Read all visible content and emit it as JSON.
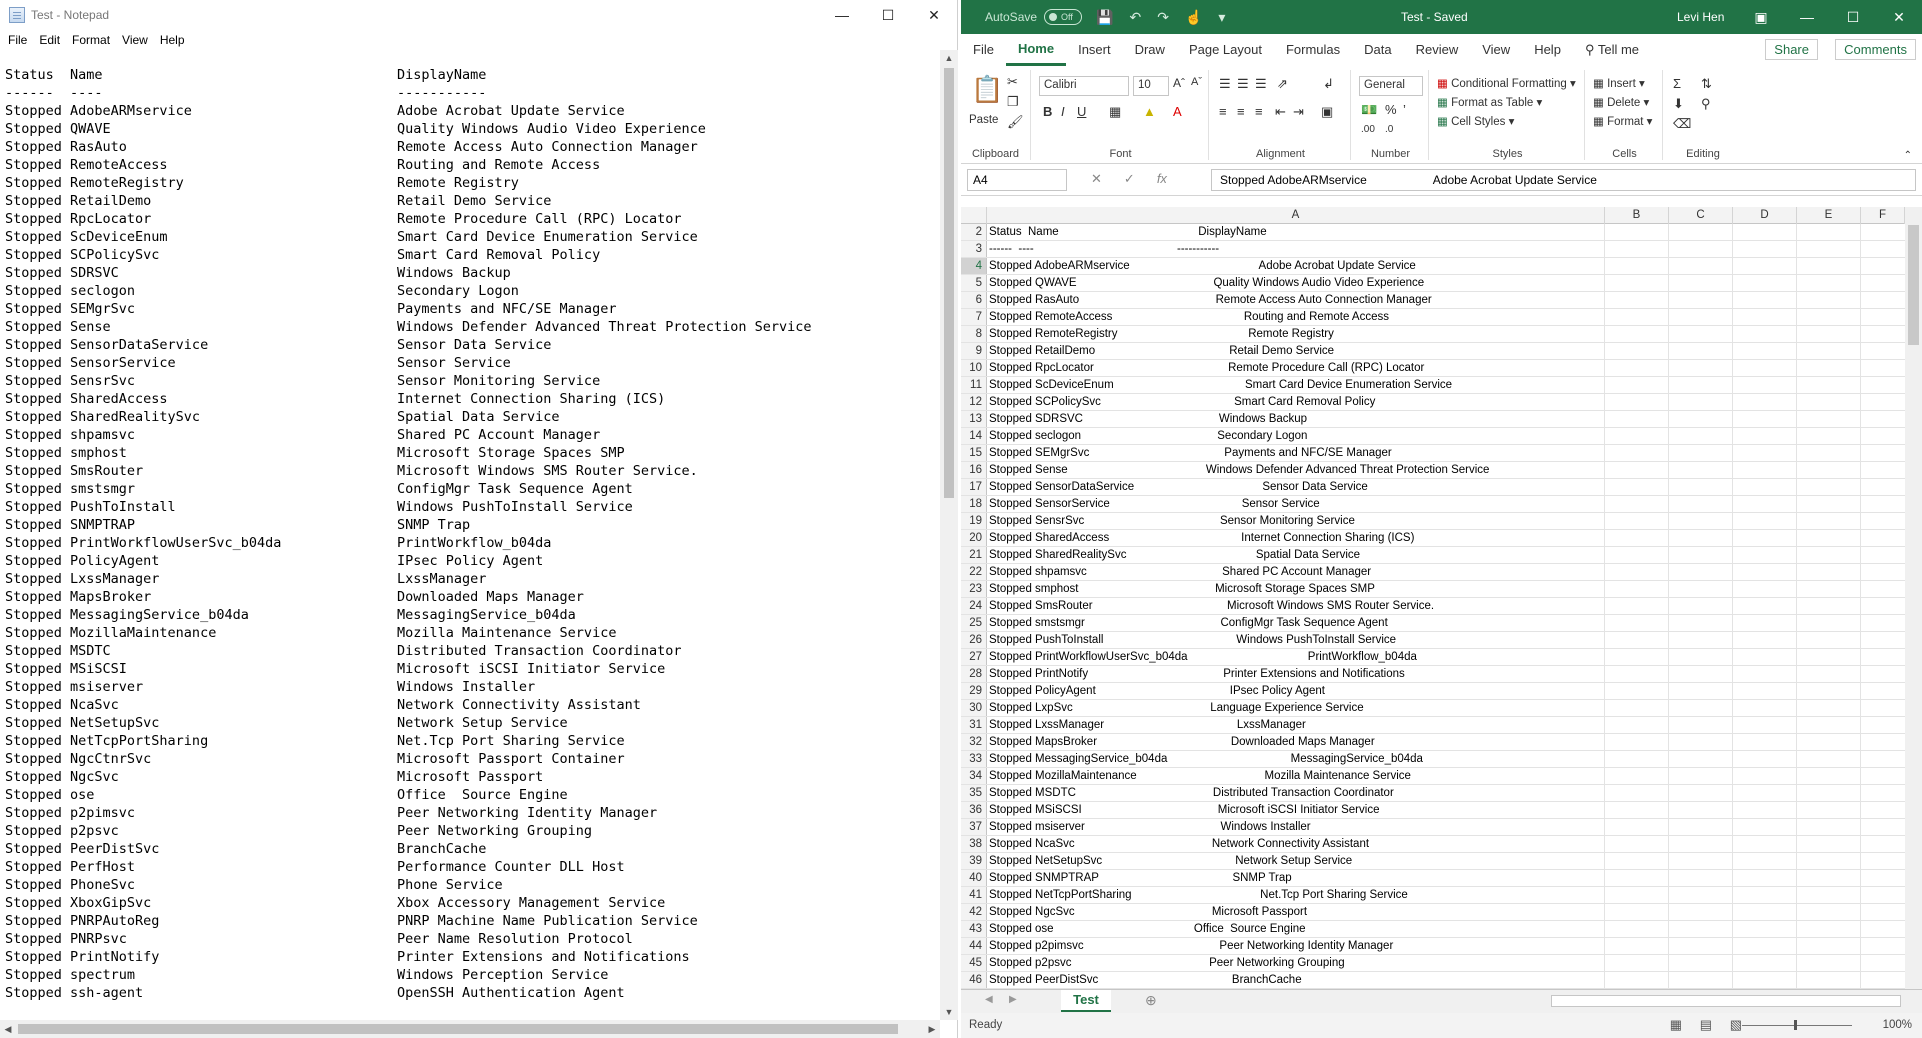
{
  "notepad": {
    "title": "Test - Notepad",
    "menu": [
      "File",
      "Edit",
      "Format",
      "View",
      "Help"
    ],
    "lines": [
      [
        "Status  Name",
        "DisplayName"
      ],
      [
        "------  ----",
        "-----------"
      ],
      [
        "Stopped AdobeARMservice",
        "Adobe Acrobat Update Service"
      ],
      [
        "Stopped QWAVE",
        "Quality Windows Audio Video Experience"
      ],
      [
        "Stopped RasAuto",
        "Remote Access Auto Connection Manager"
      ],
      [
        "Stopped RemoteAccess",
        "Routing and Remote Access"
      ],
      [
        "Stopped RemoteRegistry",
        "Remote Registry"
      ],
      [
        "Stopped RetailDemo",
        "Retail Demo Service"
      ],
      [
        "Stopped RpcLocator",
        "Remote Procedure Call (RPC) Locator"
      ],
      [
        "Stopped ScDeviceEnum",
        "Smart Card Device Enumeration Service"
      ],
      [
        "Stopped SCPolicySvc",
        "Smart Card Removal Policy"
      ],
      [
        "Stopped SDRSVC",
        "Windows Backup"
      ],
      [
        "Stopped seclogon",
        "Secondary Logon"
      ],
      [
        "Stopped SEMgrSvc",
        "Payments and NFC/SE Manager"
      ],
      [
        "Stopped Sense",
        "Windows Defender Advanced Threat Protection Service"
      ],
      [
        "Stopped SensorDataService",
        "Sensor Data Service"
      ],
      [
        "Stopped SensorService",
        "Sensor Service"
      ],
      [
        "Stopped SensrSvc",
        "Sensor Monitoring Service"
      ],
      [
        "Stopped SharedAccess",
        "Internet Connection Sharing (ICS)"
      ],
      [
        "Stopped SharedRealitySvc",
        "Spatial Data Service"
      ],
      [
        "Stopped shpamsvc",
        "Shared PC Account Manager"
      ],
      [
        "Stopped smphost",
        "Microsoft Storage Spaces SMP"
      ],
      [
        "Stopped SmsRouter",
        "Microsoft Windows SMS Router Service."
      ],
      [
        "Stopped smstsmgr",
        "ConfigMgr Task Sequence Agent"
      ],
      [
        "Stopped PushToInstall",
        "Windows PushToInstall Service"
      ],
      [
        "Stopped SNMPTRAP",
        "SNMP Trap"
      ],
      [
        "Stopped PrintWorkflowUserSvc_b04da",
        "PrintWorkflow_b04da"
      ],
      [
        "Stopped PolicyAgent",
        "IPsec Policy Agent"
      ],
      [
        "Stopped LxssManager",
        "LxssManager"
      ],
      [
        "Stopped MapsBroker",
        "Downloaded Maps Manager"
      ],
      [
        "Stopped MessagingService_b04da",
        "MessagingService_b04da"
      ],
      [
        "Stopped MozillaMaintenance",
        "Mozilla Maintenance Service"
      ],
      [
        "Stopped MSDTC",
        "Distributed Transaction Coordinator"
      ],
      [
        "Stopped MSiSCSI",
        "Microsoft iSCSI Initiator Service"
      ],
      [
        "Stopped msiserver",
        "Windows Installer"
      ],
      [
        "Stopped NcaSvc",
        "Network Connectivity Assistant"
      ],
      [
        "Stopped NetSetupSvc",
        "Network Setup Service"
      ],
      [
        "Stopped NetTcpPortSharing",
        "Net.Tcp Port Sharing Service"
      ],
      [
        "Stopped NgcCtnrSvc",
        "Microsoft Passport Container"
      ],
      [
        "Stopped NgcSvc",
        "Microsoft Passport"
      ],
      [
        "Stopped ose",
        "Office  Source Engine"
      ],
      [
        "Stopped p2pimsvc",
        "Peer Networking Identity Manager"
      ],
      [
        "Stopped p2psvc",
        "Peer Networking Grouping"
      ],
      [
        "Stopped PeerDistSvc",
        "BranchCache"
      ],
      [
        "Stopped PerfHost",
        "Performance Counter DLL Host"
      ],
      [
        "Stopped PhoneSvc",
        "Phone Service"
      ],
      [
        "Stopped XboxGipSvc",
        "Xbox Accessory Management Service"
      ],
      [
        "Stopped PNRPAutoReg",
        "PNRP Machine Name Publication Service"
      ],
      [
        "Stopped PNRPsvc",
        "Peer Name Resolution Protocol"
      ],
      [
        "Stopped PrintNotify",
        "Printer Extensions and Notifications"
      ],
      [
        "Stopped spectrum",
        "Windows Perception Service"
      ],
      [
        "Stopped ssh-agent",
        "OpenSSH Authentication Agent"
      ]
    ]
  },
  "excel": {
    "autosave_label": "AutoSave",
    "autosave_state": "Off",
    "doc_title": "Test - Saved",
    "user": "Levi Hen",
    "tabs": [
      "File",
      "Home",
      "Insert",
      "Draw",
      "Page Layout",
      "Formulas",
      "Data",
      "Review",
      "View",
      "Help"
    ],
    "tell_me": "Tell me",
    "share": "Share",
    "comments": "Comments",
    "ribbon": {
      "paste": "Paste",
      "clipboard": "Clipboard",
      "font_name": "Calibri",
      "font_size": "10",
      "font": "Font",
      "alignment": "Alignment",
      "number_format": "General",
      "number": "Number",
      "conditional_formatting": "Conditional Formatting",
      "format_as_table": "Format as Table",
      "cell_styles": "Cell Styles",
      "styles": "Styles",
      "insert": "Insert",
      "delete": "Delete",
      "format": "Format",
      "cells": "Cells",
      "editing": "Editing"
    },
    "name_box": "A4",
    "formula": "Stopped AdobeARMservice                    Adobe Acrobat Update Service",
    "columns": [
      "A",
      "B",
      "C",
      "D",
      "E",
      "F"
    ],
    "rows": [
      {
        "n": "2",
        "name": "Status  Name",
        "display": "DisplayName"
      },
      {
        "n": "3",
        "name": "------  ----",
        "display": "-----------"
      },
      {
        "n": "4",
        "name": "Stopped AdobeARMservice",
        "display": "Adobe Acrobat Update Service"
      },
      {
        "n": "5",
        "name": "Stopped QWAVE",
        "display": "Quality Windows Audio Video Experience"
      },
      {
        "n": "6",
        "name": "Stopped RasAuto",
        "display": "Remote Access Auto Connection Manager"
      },
      {
        "n": "7",
        "name": "Stopped RemoteAccess",
        "display": "Routing and Remote Access"
      },
      {
        "n": "8",
        "name": "Stopped RemoteRegistry",
        "display": "Remote Registry"
      },
      {
        "n": "9",
        "name": "Stopped RetailDemo",
        "display": "Retail Demo Service"
      },
      {
        "n": "10",
        "name": "Stopped RpcLocator",
        "display": "Remote Procedure Call (RPC) Locator"
      },
      {
        "n": "11",
        "name": "Stopped ScDeviceEnum",
        "display": "Smart Card Device Enumeration Service"
      },
      {
        "n": "12",
        "name": "Stopped SCPolicySvc",
        "display": "Smart Card Removal Policy"
      },
      {
        "n": "13",
        "name": "Stopped SDRSVC",
        "display": "Windows Backup"
      },
      {
        "n": "14",
        "name": "Stopped seclogon",
        "display": "Secondary Logon"
      },
      {
        "n": "15",
        "name": "Stopped SEMgrSvc",
        "display": "Payments and NFC/SE Manager"
      },
      {
        "n": "16",
        "name": "Stopped Sense",
        "display": "Windows Defender Advanced Threat Protection Service"
      },
      {
        "n": "17",
        "name": "Stopped SensorDataService",
        "display": "Sensor Data Service"
      },
      {
        "n": "18",
        "name": "Stopped SensorService",
        "display": "Sensor Service"
      },
      {
        "n": "19",
        "name": "Stopped SensrSvc",
        "display": "Sensor Monitoring Service"
      },
      {
        "n": "20",
        "name": "Stopped SharedAccess",
        "display": "Internet Connection Sharing (ICS)"
      },
      {
        "n": "21",
        "name": "Stopped SharedRealitySvc",
        "display": "Spatial Data Service"
      },
      {
        "n": "22",
        "name": "Stopped shpamsvc",
        "display": "Shared PC Account Manager"
      },
      {
        "n": "23",
        "name": "Stopped smphost",
        "display": "Microsoft Storage Spaces SMP"
      },
      {
        "n": "24",
        "name": "Stopped SmsRouter",
        "display": "Microsoft Windows SMS Router Service."
      },
      {
        "n": "25",
        "name": "Stopped smstsmgr",
        "display": "ConfigMgr Task Sequence Agent"
      },
      {
        "n": "26",
        "name": "Stopped PushToInstall",
        "display": "Windows PushToInstall Service"
      },
      {
        "n": "27",
        "name": "Stopped PrintWorkflowUserSvc_b04da",
        "display": "PrintWorkflow_b04da"
      },
      {
        "n": "28",
        "name": "Stopped PrintNotify",
        "display": "Printer Extensions and Notifications"
      },
      {
        "n": "29",
        "name": "Stopped PolicyAgent",
        "display": "IPsec Policy Agent"
      },
      {
        "n": "30",
        "name": "Stopped LxpSvc",
        "display": "Language Experience Service"
      },
      {
        "n": "31",
        "name": "Stopped LxssManager",
        "display": "LxssManager"
      },
      {
        "n": "32",
        "name": "Stopped MapsBroker",
        "display": "Downloaded Maps Manager"
      },
      {
        "n": "33",
        "name": "Stopped MessagingService_b04da",
        "display": "MessagingService_b04da"
      },
      {
        "n": "34",
        "name": "Stopped MozillaMaintenance",
        "display": "Mozilla Maintenance Service"
      },
      {
        "n": "35",
        "name": "Stopped MSDTC",
        "display": "Distributed Transaction Coordinator"
      },
      {
        "n": "36",
        "name": "Stopped MSiSCSI",
        "display": "Microsoft iSCSI Initiator Service"
      },
      {
        "n": "37",
        "name": "Stopped msiserver",
        "display": "Windows Installer"
      },
      {
        "n": "38",
        "name": "Stopped NcaSvc",
        "display": "Network Connectivity Assistant"
      },
      {
        "n": "39",
        "name": "Stopped NetSetupSvc",
        "display": "Network Setup Service"
      },
      {
        "n": "40",
        "name": "Stopped SNMPTRAP",
        "display": "SNMP Trap"
      },
      {
        "n": "41",
        "name": "Stopped NetTcpPortSharing",
        "display": "Net.Tcp Port Sharing Service"
      },
      {
        "n": "42",
        "name": "Stopped NgcSvc",
        "display": "Microsoft Passport"
      },
      {
        "n": "43",
        "name": "Stopped ose",
        "display": "Office  Source Engine"
      },
      {
        "n": "44",
        "name": "Stopped p2pimsvc",
        "display": "Peer Networking Identity Manager"
      },
      {
        "n": "45",
        "name": "Stopped p2psvc",
        "display": "Peer Networking Grouping"
      },
      {
        "n": "46",
        "name": "Stopped PeerDistSvc",
        "display": "BranchCache"
      }
    ],
    "sheet_tab": "Test",
    "status": "Ready",
    "zoom": "100%"
  }
}
